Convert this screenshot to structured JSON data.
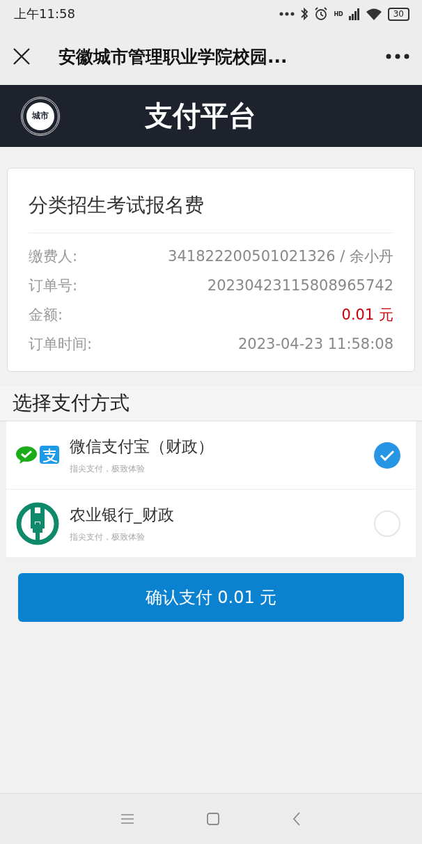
{
  "status_bar": {
    "time": "上午11:58",
    "network_label": "HD",
    "battery": "30"
  },
  "nav_bar": {
    "title": "安徽城市管理职业学院校园..."
  },
  "header": {
    "logo_text": "城市",
    "title": "支付平台"
  },
  "order": {
    "title": "分类招生考试报名费",
    "fields": [
      {
        "label": "缴费人:",
        "value": "341822200501021326 / 余小丹",
        "kind": "plain"
      },
      {
        "label": "订单号:",
        "value": "20230423115808965742",
        "kind": "plain"
      },
      {
        "label": "金额:",
        "value": "0.01 元",
        "kind": "amount"
      },
      {
        "label": "订单时间:",
        "value": "2023-04-23 11:58:08",
        "kind": "plain"
      }
    ]
  },
  "payment": {
    "title": "选择支付方式",
    "methods": [
      {
        "name": "微信支付宝（财政）",
        "note": "指尖支付，极致体验",
        "kind": "wechat-alipay",
        "selected": true
      },
      {
        "name": "农业银行_财政",
        "note": "指尖支付，极致体验",
        "kind": "bank",
        "selected": false
      }
    ]
  },
  "confirm_button": "确认支付 0.01 元"
}
